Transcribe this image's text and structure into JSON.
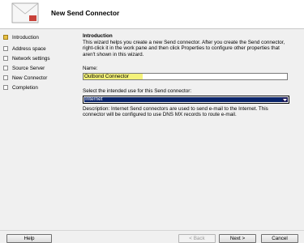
{
  "window": {
    "title": "New Send Connector"
  },
  "nav": {
    "items": [
      {
        "label": "Introduction",
        "current": true
      },
      {
        "label": "Address space",
        "current": false
      },
      {
        "label": "Network settings",
        "current": false
      },
      {
        "label": "Source Server",
        "current": false
      },
      {
        "label": "New Connector",
        "current": false
      },
      {
        "label": "Completion",
        "current": false
      }
    ]
  },
  "intro": {
    "title": "Introduction",
    "text": "This wizard helps you create a new Send connector. After you create the Send connector, right-click it in the work pane and then click Properties to configure other properties that aren't shown in this wizard.",
    "name_label": "Name:",
    "name_value": "Outbond Connector",
    "use_label": "Select the intended use for this Send connector:",
    "use_value": "Internet",
    "description": "Description: Internet Send connectors are used to send e-mail to the Internet. This connector will be configured to use DNS MX records to route e-mail."
  },
  "footer": {
    "help": "Help",
    "back": "< Back",
    "next": "Next >",
    "cancel": "Cancel"
  },
  "colors": {
    "current_step": "#e8c044",
    "selection": "#0a246a",
    "highlight": "#f4f27a"
  },
  "icons": {
    "wizard": "envelope-icon",
    "dropdown": "chevron-down-icon"
  }
}
